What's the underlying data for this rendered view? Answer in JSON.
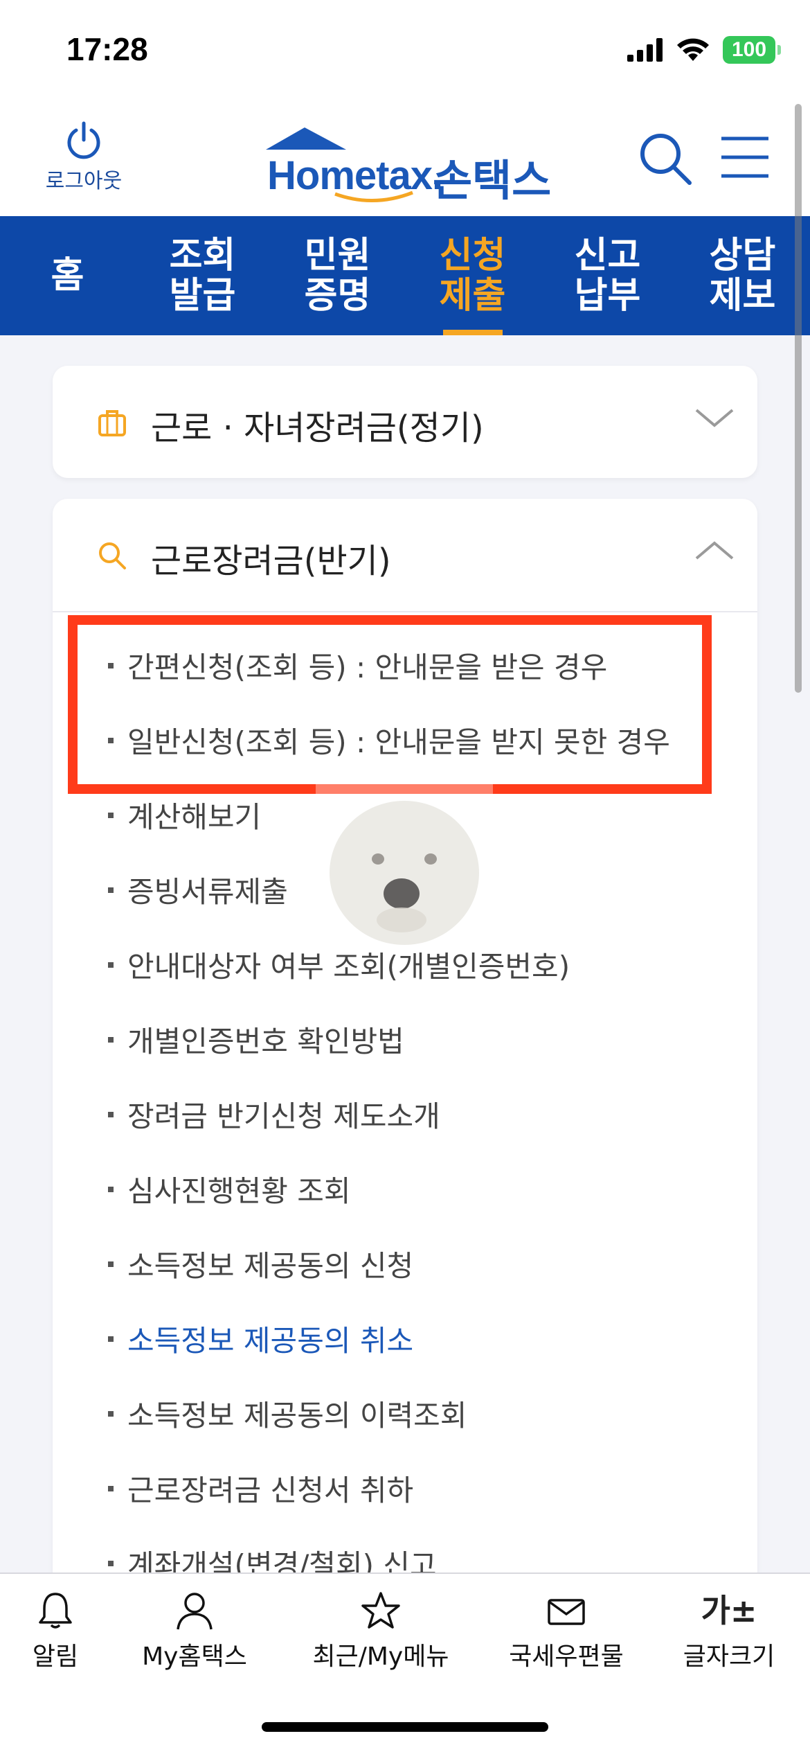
{
  "status": {
    "time": "17:28",
    "battery": "100"
  },
  "header": {
    "logout_label": "로그아웃",
    "logo_text": "Hometax.",
    "logo_kr": "손택스"
  },
  "nav": [
    {
      "label": "홈"
    },
    {
      "label": "조회\n발급"
    },
    {
      "label": "민원\n증명"
    },
    {
      "label": "신청\n제출",
      "active": true
    },
    {
      "label": "신고\n납부"
    },
    {
      "label": "상담\n제보"
    }
  ],
  "card1": {
    "title": "근로 · 자녀장려금(정기)"
  },
  "card2": {
    "title": "근로장려금(반기)",
    "items": [
      "간편신청(조회 등) : 안내문을 받은 경우",
      "일반신청(조회 등) : 안내문을 받지 못한 경우",
      "계산해보기",
      "증빙서류제출",
      "안내대상자 여부 조회(개별인증번호)",
      "개별인증번호 확인방법",
      "장려금 반기신청 제도소개",
      "심사진행현황 조회",
      "소득정보 제공동의 신청",
      "소득정보 제공동의 취소",
      "소득정보 제공동의 이력조회",
      "근로장려금 신청서 취하",
      "계좌개설(변경/철회) 신고"
    ]
  },
  "tabbar": {
    "alarm": "알림",
    "my_hometax": "My홈택스",
    "recent": "최근/My메뉴",
    "mail": "국세우편물",
    "font_size": "글자크기",
    "font_size_icon_text": "가±"
  },
  "colors": {
    "primary": "#0d48a8",
    "accent": "#f5a623",
    "highlight": "#ff3b1a",
    "link": "#1b58b8"
  }
}
